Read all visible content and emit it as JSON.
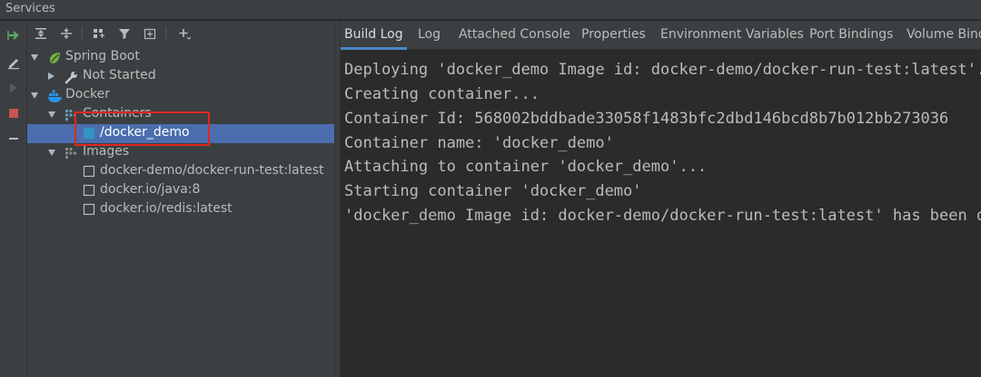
{
  "window": {
    "title": "Services"
  },
  "toolbar": {
    "icons": [
      "expand-all-icon",
      "collapse-all-icon",
      "group-by-icon",
      "filter-icon",
      "new-tab-icon",
      "add-service-icon"
    ]
  },
  "leftbar": {
    "icons": [
      "rerun-icon",
      "edit-icon",
      "run-icon",
      "stop-icon",
      "minus-icon"
    ]
  },
  "tree": {
    "spring_boot": {
      "label": "Spring Boot",
      "not_started": "Not Started"
    },
    "docker": {
      "label": "Docker",
      "containers": {
        "label": "Containers",
        "items": [
          "/docker_demo"
        ]
      },
      "images": {
        "label": "Images",
        "items": [
          "docker-demo/docker-run-test:latest",
          "docker.io/java:8",
          "docker.io/redis:latest"
        ]
      }
    }
  },
  "tabs": [
    "Build Log",
    "Log",
    "Attached Console",
    "Properties",
    "Environment Variables",
    "Port Bindings",
    "Volume Bindings"
  ],
  "active_tab": "Build Log",
  "console": {
    "lines": [
      "Deploying 'docker_demo Image id: docker-demo/docker-run-test:latest'...",
      "Creating container...",
      "Container Id: 568002bddbade33058f1483bfc2dbd146bcd8b7b012bb273036",
      "Container name: 'docker_demo'",
      "Attaching to container 'docker_demo'...",
      "Starting container 'docker_demo'",
      "'docker_demo Image id: docker-demo/docker-run-test:latest' has been deployed successfully."
    ]
  },
  "colors": {
    "selection": "#4b6eaf",
    "highlight_box": "#e0281e",
    "tab_underline": "#4a88c7",
    "spring_green": "#6db33f",
    "docker_blue": "#2496ed"
  }
}
